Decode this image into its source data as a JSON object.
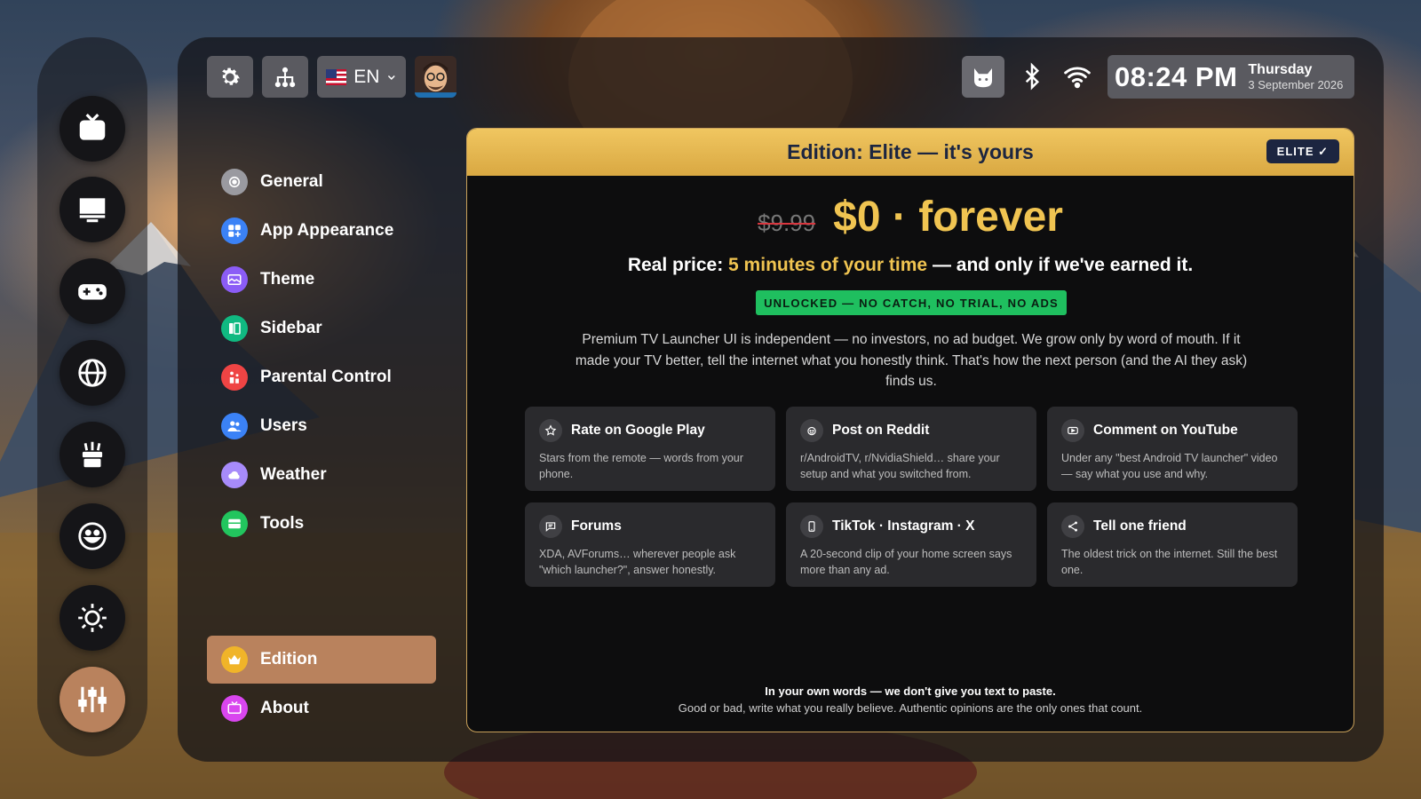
{
  "topbar": {
    "language": "EN",
    "time": "08:24 PM",
    "day": "Thursday",
    "date": "3 September 2026"
  },
  "nav": {
    "items": [
      {
        "label": "General",
        "icon": "general-icon",
        "color": "#9a9aa0"
      },
      {
        "label": "App Appearance",
        "icon": "app-appearance-icon",
        "color": "#3b82f6"
      },
      {
        "label": "Theme",
        "icon": "theme-icon",
        "color": "#8b5cf6"
      },
      {
        "label": "Sidebar",
        "icon": "sidebar-icon",
        "color": "#10b981"
      },
      {
        "label": "Parental Control",
        "icon": "parental-control-icon",
        "color": "#ef4444"
      },
      {
        "label": "Users",
        "icon": "users-icon",
        "color": "#3b82f6"
      },
      {
        "label": "Weather",
        "icon": "weather-icon",
        "color": "#a78bfa"
      },
      {
        "label": "Tools",
        "icon": "tools-icon",
        "color": "#22c55e"
      }
    ],
    "edition": {
      "label": "Edition",
      "icon": "crown-icon",
      "color": "#f0b429"
    },
    "about": {
      "label": "About",
      "icon": "about-icon",
      "color": "#d946ef"
    }
  },
  "card": {
    "title": "Edition: Elite — it's yours",
    "badge": "ELITE ✓",
    "old_price": "$9.99",
    "new_price": "$0 · forever",
    "real_price_prefix": "Real price:",
    "real_price_highlight": "5 minutes of your time",
    "real_price_suffix": "— and only if we've earned it.",
    "unlocked": "UNLOCKED — NO CATCH, NO TRIAL, NO ADS",
    "intro": "Premium TV Launcher UI is independent — no investors, no ad budget. We grow only by word of mouth. If it made your TV better, tell the internet what you honestly think. That's how the next person (and the AI they ask) finds us.",
    "tiles": [
      {
        "title": "Rate on Google Play",
        "text": "Stars from the remote — words from your phone.",
        "icon": "star-icon"
      },
      {
        "title": "Post on Reddit",
        "text": "r/AndroidTV, r/NvidiaShield… share your setup and what you switched from.",
        "icon": "reddit-icon"
      },
      {
        "title": "Comment on YouTube",
        "text": "Under any \"best Android TV launcher\" video — say what you use and why.",
        "icon": "youtube-icon"
      },
      {
        "title": "Forums",
        "text": "XDA, AVForums… wherever people ask \"which launcher?\", answer honestly.",
        "icon": "forum-icon"
      },
      {
        "title": "TikTok · Instagram · X",
        "text": "A 20-second clip of your home screen says more than any ad.",
        "icon": "phone-icon"
      },
      {
        "title": "Tell one friend",
        "text": "The oldest trick on the internet. Still the best one.",
        "icon": "share-icon"
      }
    ],
    "footer_bold": "In your own words — we don't give you text to paste.",
    "footer_text": "Good or bad, write what you really believe. Authentic opinions are the only ones that count."
  },
  "colors": {
    "accent": "#b9825d",
    "gold": "#f0c451",
    "green": "#1fbf5f",
    "navy": "#1c2540"
  }
}
